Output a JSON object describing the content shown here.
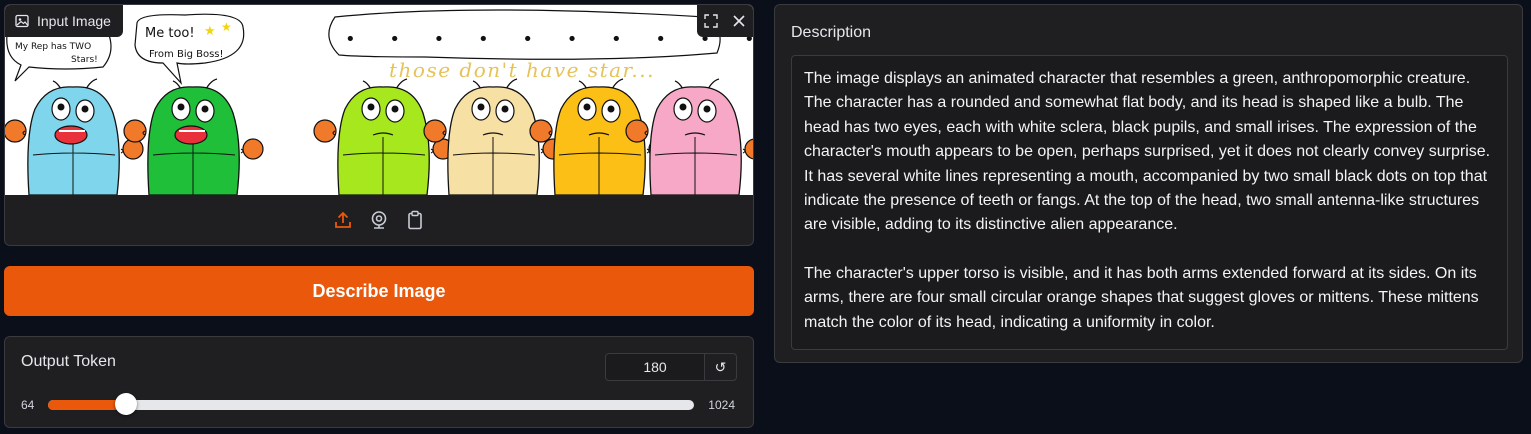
{
  "image_input": {
    "label": "Input Image",
    "bubble_1": [
      "My Rep has TWO",
      "Stars!"
    ],
    "bubble_2": [
      "Me too!",
      "From Big Boss!"
    ],
    "bubble_3": "• • • • • • • • • • • •",
    "caption": "those don't have star...",
    "characters": [
      {
        "color": "#7fd6ec"
      },
      {
        "color": "#1fbf3a"
      },
      {
        "color": "#a6e81d"
      },
      {
        "color": "#f7e0a4"
      },
      {
        "color": "#fbbf16"
      },
      {
        "color": "#f7a8c6"
      }
    ],
    "mitten_color": "#f07a2a",
    "icons": [
      "image-icon",
      "fullscreen-icon",
      "close-icon",
      "upload-icon",
      "webcam-icon",
      "clipboard-icon"
    ]
  },
  "describe_button": {
    "label": "Describe Image",
    "color": "#ea580c"
  },
  "slider": {
    "label": "Output Token",
    "value": "180",
    "min": "64",
    "max": "1024",
    "fraction": 0.1208,
    "reset_icon": "↺"
  },
  "description": {
    "label": "Description",
    "paragraphs": [
      "The image displays an animated character that resembles a green, anthropomorphic creature. The character has a rounded and somewhat flat body, and its head is shaped like a bulb. The head has two eyes, each with white sclera, black pupils, and small irises. The expression of the character's mouth appears to be open, perhaps surprised, yet it does not clearly convey surprise. It has several white lines representing a mouth, accompanied by two small black dots on top that indicate the presence of teeth or fangs. At the top of the head, two small antenna-like structures are visible, adding to its distinctive alien appearance.",
      "The character's upper torso is visible, and it has both arms extended forward at its sides. On its arms, there are four small circular orange shapes that suggest gloves or mittens. These mittens match the color of its head, indicating a uniformity in color."
    ]
  },
  "colors": {
    "background": "#0b0f19",
    "panel": "#1f1f22",
    "accent": "#ea580c"
  }
}
